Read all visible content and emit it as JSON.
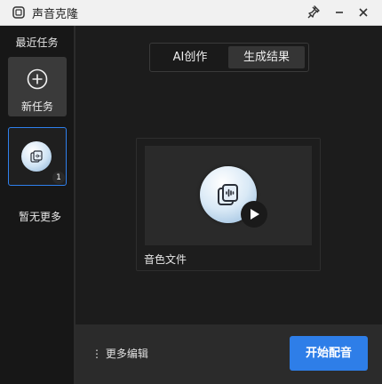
{
  "window": {
    "title": "声音克隆",
    "icons": {
      "app": "app-icon",
      "pin": "pin-icon",
      "minimize": "minimize-icon",
      "close": "close-icon"
    }
  },
  "sidebar": {
    "title": "最近任务",
    "new_task_label": "新任务",
    "task_count": "1",
    "no_more": "暂无更多"
  },
  "tabs": [
    {
      "label": "AI创作",
      "active": false
    },
    {
      "label": "生成结果",
      "active": true
    }
  ],
  "result": {
    "caption": "音色文件"
  },
  "bottom": {
    "more_edit": "⋮ 更多编辑",
    "start_button": "开始配音"
  },
  "colors": {
    "accent": "#2e7ee8",
    "background": "#1c1c1c",
    "sidebar": "#171717"
  }
}
